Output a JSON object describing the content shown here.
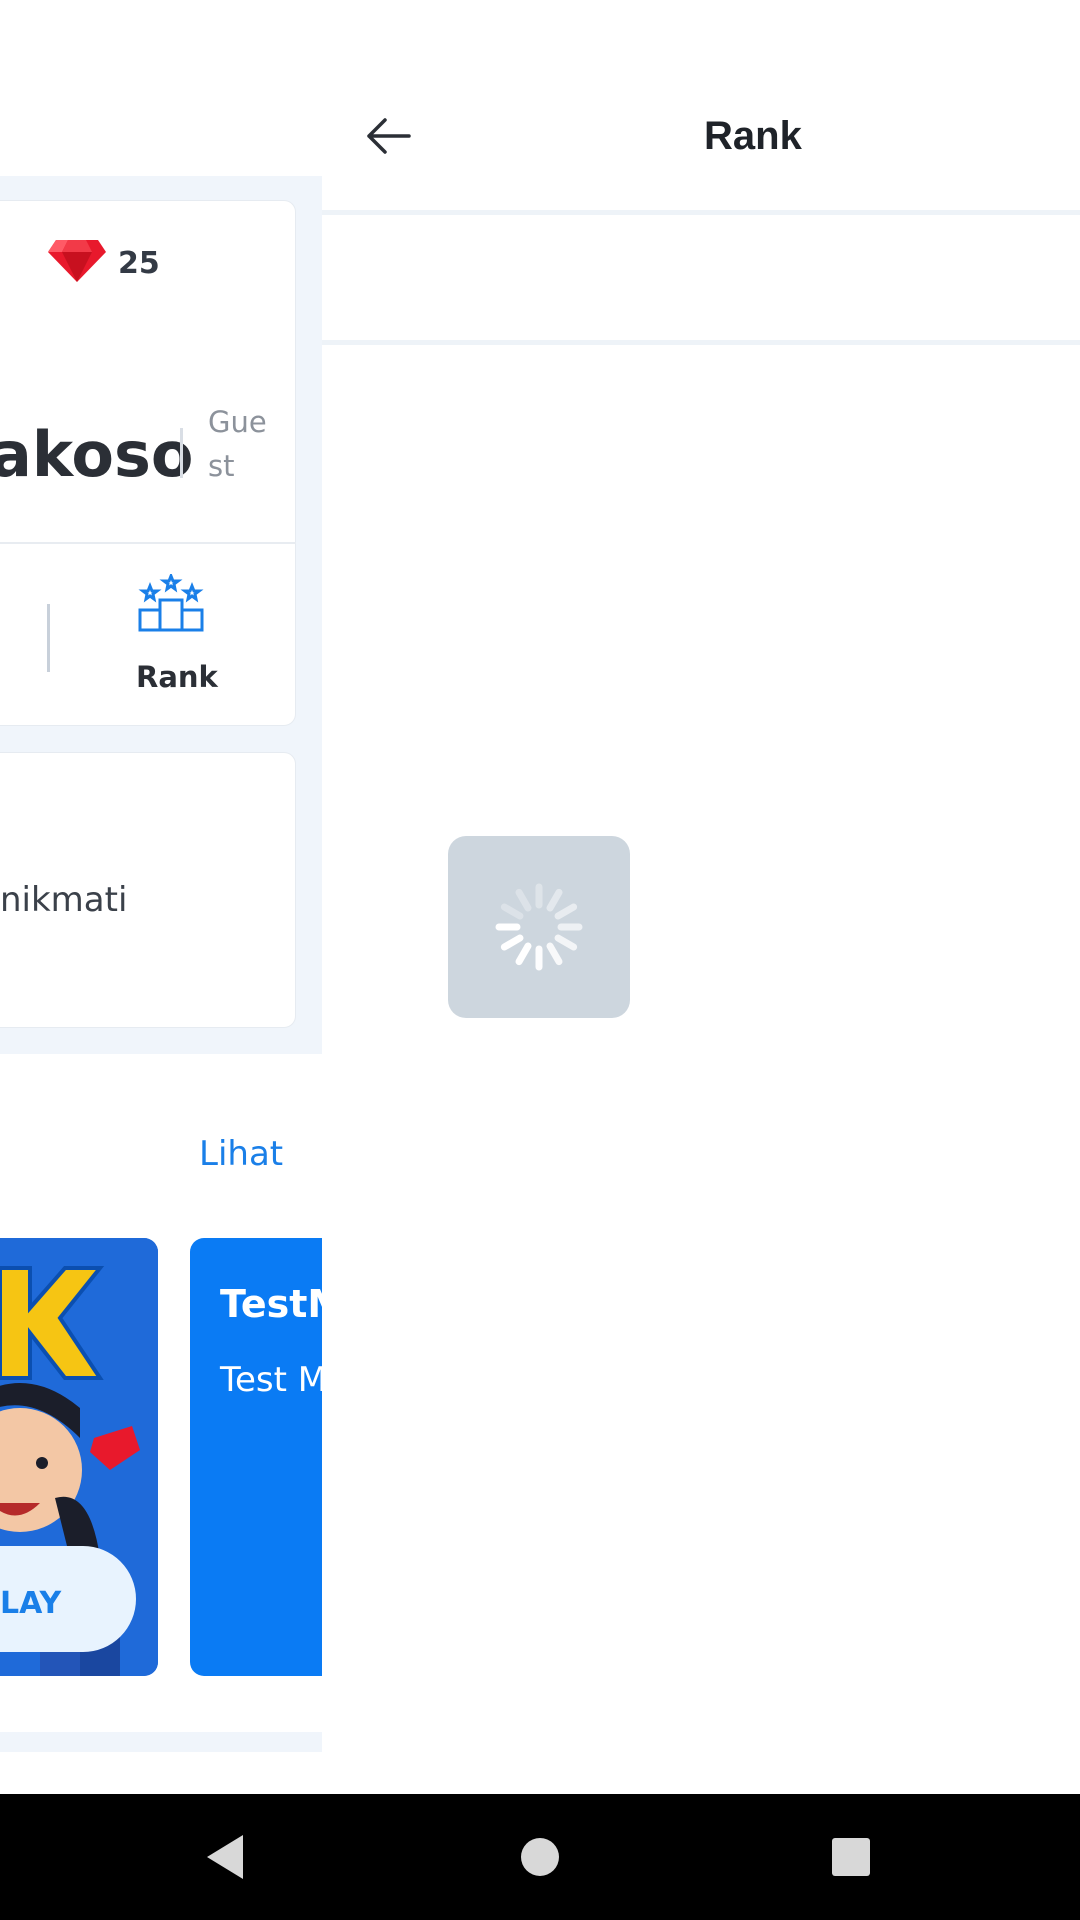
{
  "background_screen": {
    "gem_count": "25",
    "user_name": "akoso",
    "user_role": "Guest",
    "rank_label": "Rank",
    "card_text": "nikmati",
    "see_all_label": "Lihat",
    "tile_title": "TestM",
    "tile_subtitle": "Test M",
    "play_label": "LAY"
  },
  "rank_page": {
    "title": "Rank",
    "loading": true
  },
  "icons": {
    "back": "arrow-left-icon",
    "gem": "gem-icon",
    "rank": "podium-stars-icon",
    "spinner": "loading-spinner-icon",
    "nav_back": "triangle-back-icon",
    "nav_home": "circle-home-icon",
    "nav_recents": "square-recents-icon"
  },
  "colors": {
    "accent": "#1a7fe8",
    "gem": "#e8192c",
    "panel_bg": "#f0f5fb",
    "loader_bg": "#cdd6de"
  }
}
